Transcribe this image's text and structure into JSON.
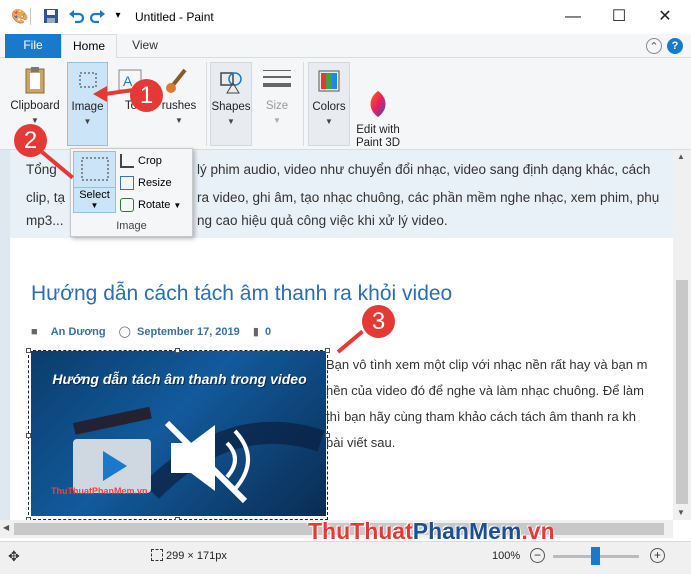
{
  "window": {
    "title": "Untitled - Paint",
    "minimize_glyph": "—",
    "maximize_glyph": "☐",
    "close_glyph": "✕"
  },
  "quick_access": {
    "icon": "paint-app-icon",
    "save_icon": "save-icon",
    "undo_icon": "undo-icon",
    "redo_icon": "redo-icon",
    "customize_glyph": "▾"
  },
  "tabs": {
    "file": "File",
    "home": "Home",
    "view": "View"
  },
  "ribbon": {
    "clipboard": "Clipboard",
    "image": "Image",
    "tools": "To",
    "brushes": "rushes",
    "shapes": "Shapes",
    "size": "Size",
    "colors": "Colors",
    "paint3d": "Edit with\nPaint 3D"
  },
  "dropdown": {
    "select": "Select",
    "crop": "Crop",
    "resize": "Resize",
    "rotate": "Rotate",
    "group_title": "Image"
  },
  "canvas_content": {
    "strip_line1_left": "Tổng",
    "strip_line1_right": "lý phim audio, video như chuyển đổi nhạc, video sang định dạng khác, cách",
    "strip_line2_left": "clip, tạ",
    "strip_line2_right": "ra video, ghi âm, tạo nhạc chuông, các phần mềm nghe nhạc, xem phim, phụ",
    "strip_line3_left": "mp3...",
    "strip_line3_right": "ng cao hiệu quả công việc khi xử lý video.",
    "heading": "Hướng dẫn cách tách âm thanh ra khỏi video",
    "author": "An Dương",
    "date": "September 17, 2019",
    "comments": "0",
    "thumb_title": "Hướng dẫn tách âm thanh trong video",
    "thumb_watermark": "ThuThuatPhanMem.vn",
    "body_lines": [
      "Bạn vô tình xem một clip với nhạc nền rất hay và bạn m",
      "nền của video đó để nghe và làm nhạc chuông. Để làm",
      "thì bạn hãy cùng tham khảo cách tách âm thanh ra kh",
      "bài viết sau."
    ]
  },
  "statusbar": {
    "dimensions": "299 × 171px",
    "zoom": "100%",
    "zoom_level_percent": 100
  },
  "callouts": [
    "1",
    "2",
    "3"
  ],
  "brand": {
    "part1": "ThuThuat",
    "part2": "PhanMem",
    "part3": ".vn"
  },
  "colors": {
    "accent": "#1979ca",
    "callout": "#e53935",
    "heading": "#2a6fb6"
  }
}
